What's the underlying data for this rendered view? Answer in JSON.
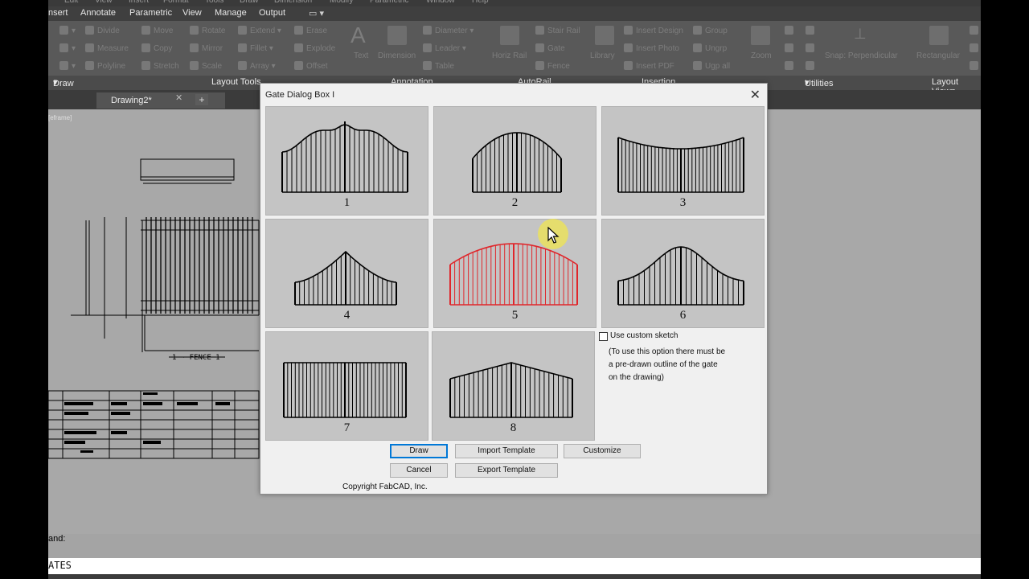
{
  "menu": [
    "nsert",
    "Annotate",
    "Parametric",
    "View",
    "Manage",
    "Output"
  ],
  "ribbon_tools": {
    "modify": [
      "Move",
      "Rotate",
      "Extend",
      "Erase",
      "Copy",
      "Mirror",
      "Fillet",
      "Explode",
      "Stretch",
      "Scale",
      "Array",
      "Offset"
    ],
    "annotation": [
      "Text",
      "Dimension",
      "Diameter",
      "Leader",
      "Table"
    ],
    "autorail": [
      "Horiz Rail",
      "Stair Rail",
      "Gate",
      "Fence"
    ],
    "insertion": [
      "Library",
      "Insert Design",
      "Insert Photo",
      "Insert PDF",
      "Group",
      "Ungrp",
      "Ugp all"
    ],
    "utilities": [
      "Zoom",
      "Snap: Perpendicular",
      "Rectangular"
    ]
  },
  "ribbon_panels": {
    "draw": "Draw",
    "layout_tools": "Layout Tools",
    "annotation": "Annotation",
    "autorail": "AutoRail",
    "insertion": "Insertion",
    "utilities": "Utilities",
    "layout_viewports": "Layout Viewp"
  },
  "document_tab": {
    "name": "Drawing2*",
    "close": "✕",
    "new": "+"
  },
  "drawing": {
    "view_label": "[eframe]",
    "fence_label": "1 ~ FENCE 1"
  },
  "command": {
    "prompt": "and:",
    "input": "ATES"
  },
  "dialog": {
    "title": "Gate Dialog Box I",
    "close_label": "✕",
    "gates": [
      {
        "number": "1",
        "style": "double-ogee",
        "selected": false
      },
      {
        "number": "2",
        "style": "arch",
        "selected": false
      },
      {
        "number": "3",
        "style": "inverted-arch",
        "selected": false
      },
      {
        "number": "4",
        "style": "rising-peak",
        "selected": false
      },
      {
        "number": "5",
        "style": "double-arch",
        "selected": true
      },
      {
        "number": "6",
        "style": "bell",
        "selected": false
      },
      {
        "number": "7",
        "style": "flat",
        "selected": false
      },
      {
        "number": "8",
        "style": "peak",
        "selected": false
      }
    ],
    "custom_sketch_label": "Use custom sketch",
    "custom_sketch_checked": false,
    "custom_sketch_note": [
      "(To use this option there must be",
      "a pre-drawn outline of the gate",
      "on the drawing)"
    ],
    "buttons": {
      "draw": "Draw",
      "import_template": "Import Template",
      "customize": "Customize",
      "cancel": "Cancel",
      "export_template": "Export Template"
    },
    "copyright": "Copyright FabCAD, Inc."
  },
  "colors": {
    "selected_gate": "#e0262b",
    "default_button_border": "#0078d7",
    "tile_bg": "#c4c4c4",
    "dialog_bg": "#f0f0f0"
  }
}
